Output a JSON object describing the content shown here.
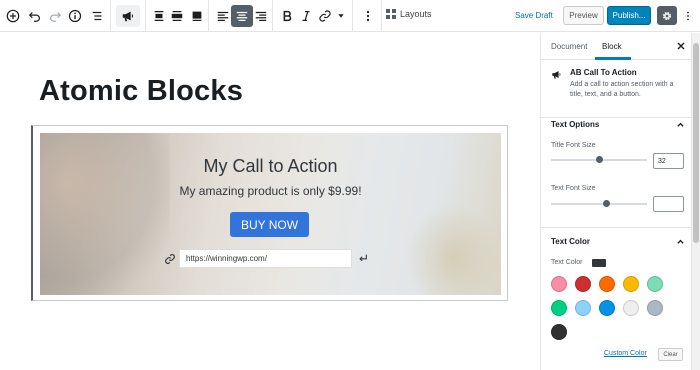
{
  "toolbar": {
    "layouts_label": "Layouts",
    "save_draft_label": "Save Draft",
    "preview_label": "Preview",
    "publish_label": "Publish..."
  },
  "editor": {
    "post_title": "Atomic Blocks",
    "cta": {
      "title": "My Call to Action",
      "text": "My amazing product is only $9.99!",
      "button_label": "BUY NOW",
      "url_value": "https://winningwp.com/"
    }
  },
  "sidebar": {
    "tabs": [
      {
        "label": "Document",
        "active": false
      },
      {
        "label": "Block",
        "active": true
      }
    ],
    "block": {
      "name": "AB Call To Action",
      "description": "Add a call to action section with a title, text, and a button."
    },
    "text_options": {
      "heading": "Text Options",
      "title_font_size_label": "Title Font Size",
      "title_font_size_value": "32",
      "title_font_size_level": 0.5,
      "text_font_size_label": "Text Font Size",
      "text_font_size_value": "",
      "text_font_size_level": 0.58
    },
    "text_color": {
      "heading": "Text Color",
      "label": "Text Color",
      "current": "#32373c",
      "swatches": [
        "#f78da7",
        "#cf2e2e",
        "#ff6900",
        "#fcb900",
        "#7bdcb5",
        "#00d084",
        "#8ed1fc",
        "#0693e3",
        "#eeeeee",
        "#abb8c3",
        "#313131"
      ],
      "custom_color_label": "Custom Color",
      "clear_label": "Clear"
    }
  }
}
